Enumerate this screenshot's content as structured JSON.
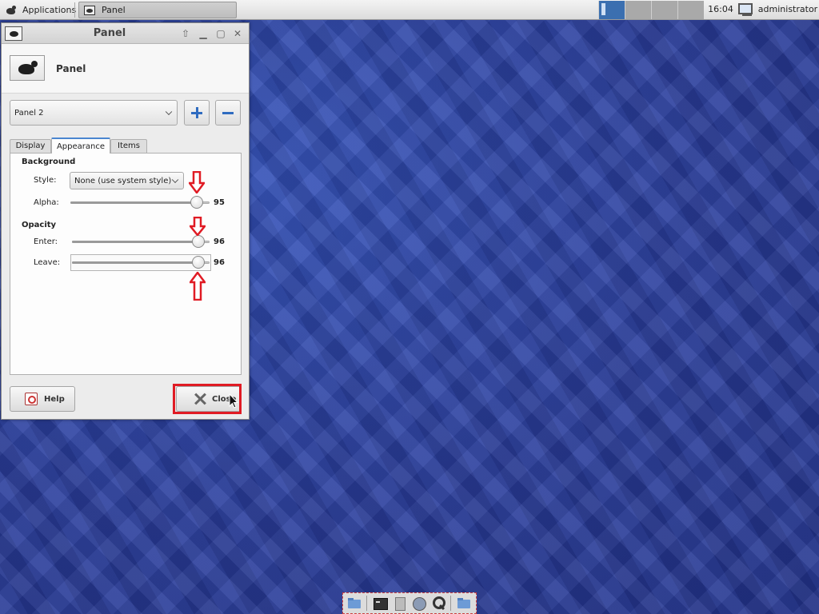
{
  "top_panel": {
    "applications_label": "Applications",
    "task_label": "Panel",
    "clock": "16:04",
    "user": "administrator",
    "workspaces": 4
  },
  "window": {
    "title": "Panel",
    "header_title": "Panel",
    "panel_select": "Panel 2",
    "tabs": [
      "Display",
      "Appearance",
      "Items"
    ],
    "active_tab": "Appearance",
    "background_section": "Background",
    "style_label": "Style:",
    "style_value": "None (use system style)",
    "alpha_label": "Alpha:",
    "alpha_value": 95,
    "opacity_section": "Opacity",
    "enter_label": "Enter:",
    "enter_value": 96,
    "leave_label": "Leave:",
    "leave_value": 96,
    "help_label": "Help",
    "close_label": "Close"
  },
  "dock": {
    "items": [
      "folder-icon",
      "terminal-icon",
      "files-icon",
      "browser-icon",
      "search-icon",
      "folder-icon"
    ]
  },
  "colors": {
    "highlight": "#e01b24",
    "desktop": "#2c3f9a",
    "accent": "#2f6cc0"
  }
}
